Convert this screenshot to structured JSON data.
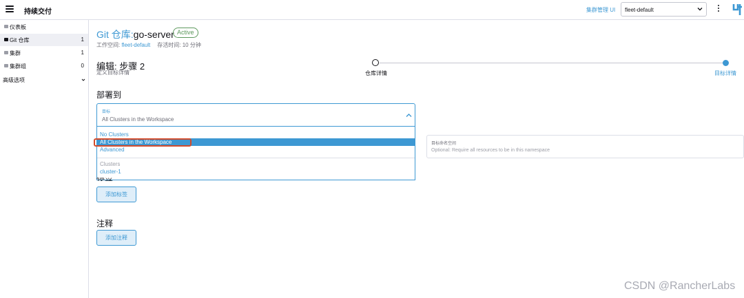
{
  "header": {
    "title": "持续交付",
    "cluster_manager_link": "集群管理 UI",
    "workspace_select": "fleet-default"
  },
  "sidebar": {
    "items": [
      {
        "label": "仪表板",
        "count": ""
      },
      {
        "label": "Git 仓库",
        "count": "1"
      },
      {
        "label": "集群",
        "count": "1"
      },
      {
        "label": "集群组",
        "count": "0"
      }
    ],
    "advanced_label": "高级选项"
  },
  "repo": {
    "prefix": "Git 仓库:",
    "name": "go-server",
    "status": "Active",
    "workspace_label": "工作空间: ",
    "workspace_value": "fleet-default",
    "age_text": "存活时间: 10 分钟"
  },
  "step": {
    "title": "编辑: 步骤 2",
    "subtitle": "定义目标详情",
    "steps": [
      "仓库详情",
      "目标详情"
    ]
  },
  "deploy": {
    "heading": "部署到",
    "target_label": "目标",
    "target_value": "All Clusters in the Workspace",
    "options": [
      "No Clusters",
      "All Clusters in the Workspace",
      "Advanced"
    ],
    "group_label": "Clusters",
    "group_options": [
      "cluster-1"
    ]
  },
  "namespace": {
    "label": "目标命名空间",
    "placeholder": "Optional: Require all resources to be in this namespace"
  },
  "labels": {
    "heading": "标签",
    "add_button": "添加标签"
  },
  "annotations": {
    "heading": "注释",
    "add_button": "添加注释"
  },
  "watermark": "CSDN @RancherLabs",
  "colors": {
    "accent": "#3d98d3",
    "success": "#5d995d",
    "highlight_outline": "#d24a2a"
  }
}
